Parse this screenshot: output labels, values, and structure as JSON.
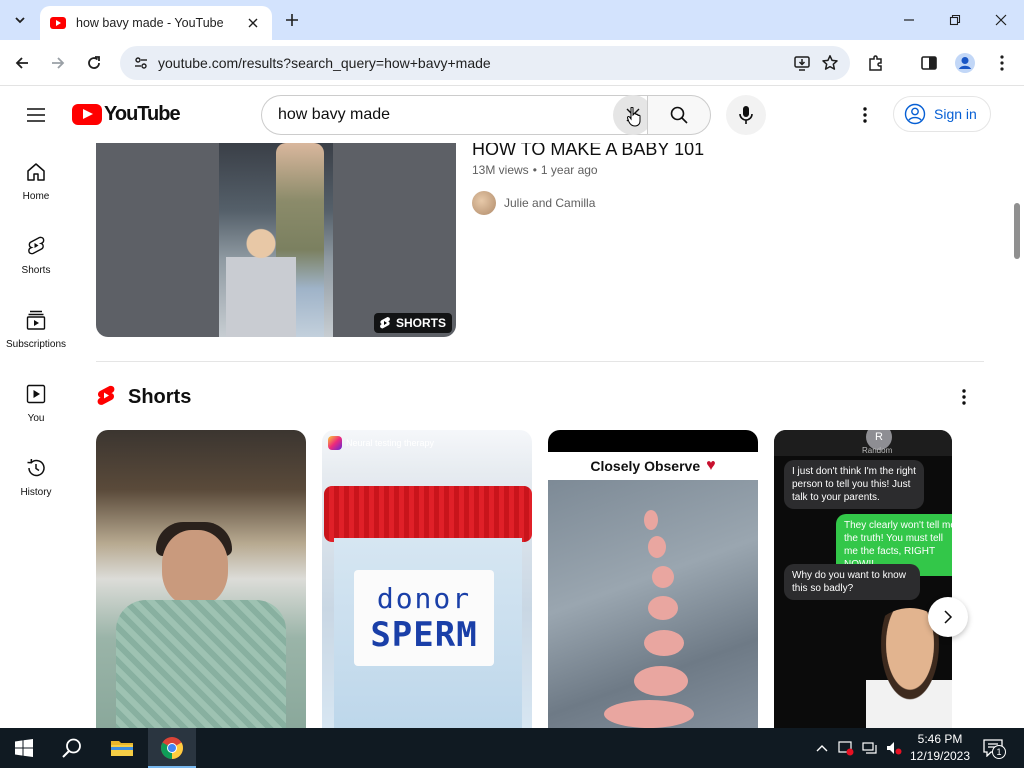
{
  "browser": {
    "tab": {
      "title": "how bavy made - YouTube"
    },
    "address": {
      "url": "youtube.com/results?search_query=how+bavy+made"
    }
  },
  "masthead": {
    "logo_text": "YouTube",
    "search": {
      "query": "how bavy made"
    },
    "signin_label": "Sign in"
  },
  "guide": {
    "items": [
      {
        "label": "Home",
        "icon": "home-icon"
      },
      {
        "label": "Shorts",
        "icon": "shorts-icon"
      },
      {
        "label": "Subscriptions",
        "icon": "subscriptions-icon"
      },
      {
        "label": "You",
        "icon": "you-icon"
      },
      {
        "label": "History",
        "icon": "history-icon"
      }
    ]
  },
  "results": {
    "video": {
      "title": "HOW TO MAKE A BABY 101",
      "views": "13M views",
      "age": "1 year ago",
      "channel": "Julie and Camilla",
      "badge": "SHORTS"
    },
    "shelf": {
      "title": "Shorts",
      "items": [
        {
          "overlay_text": ""
        },
        {
          "overlay_text": "Neural testing therapy",
          "label_line1": "donor",
          "label_line2": "SPERM"
        },
        {
          "overlay_text": "Closely Observe"
        },
        {
          "header": "Random",
          "avatar_letter": "R",
          "messages": [
            "I just don't think I'm the right person to tell you this! Just talk to your parents.",
            "They clearly won't tell me the truth! You must tell me the facts, RIGHT NOW!!",
            "Why do you want to know this so badly?"
          ]
        }
      ]
    }
  },
  "taskbar": {
    "time": "5:46 PM",
    "date": "12/19/2023",
    "notification_count": "1"
  },
  "colors": {
    "brand": "#ff0000",
    "link": "#065fd4",
    "tabstrip": "#d3e3fd",
    "taskbar": "#101a22"
  }
}
